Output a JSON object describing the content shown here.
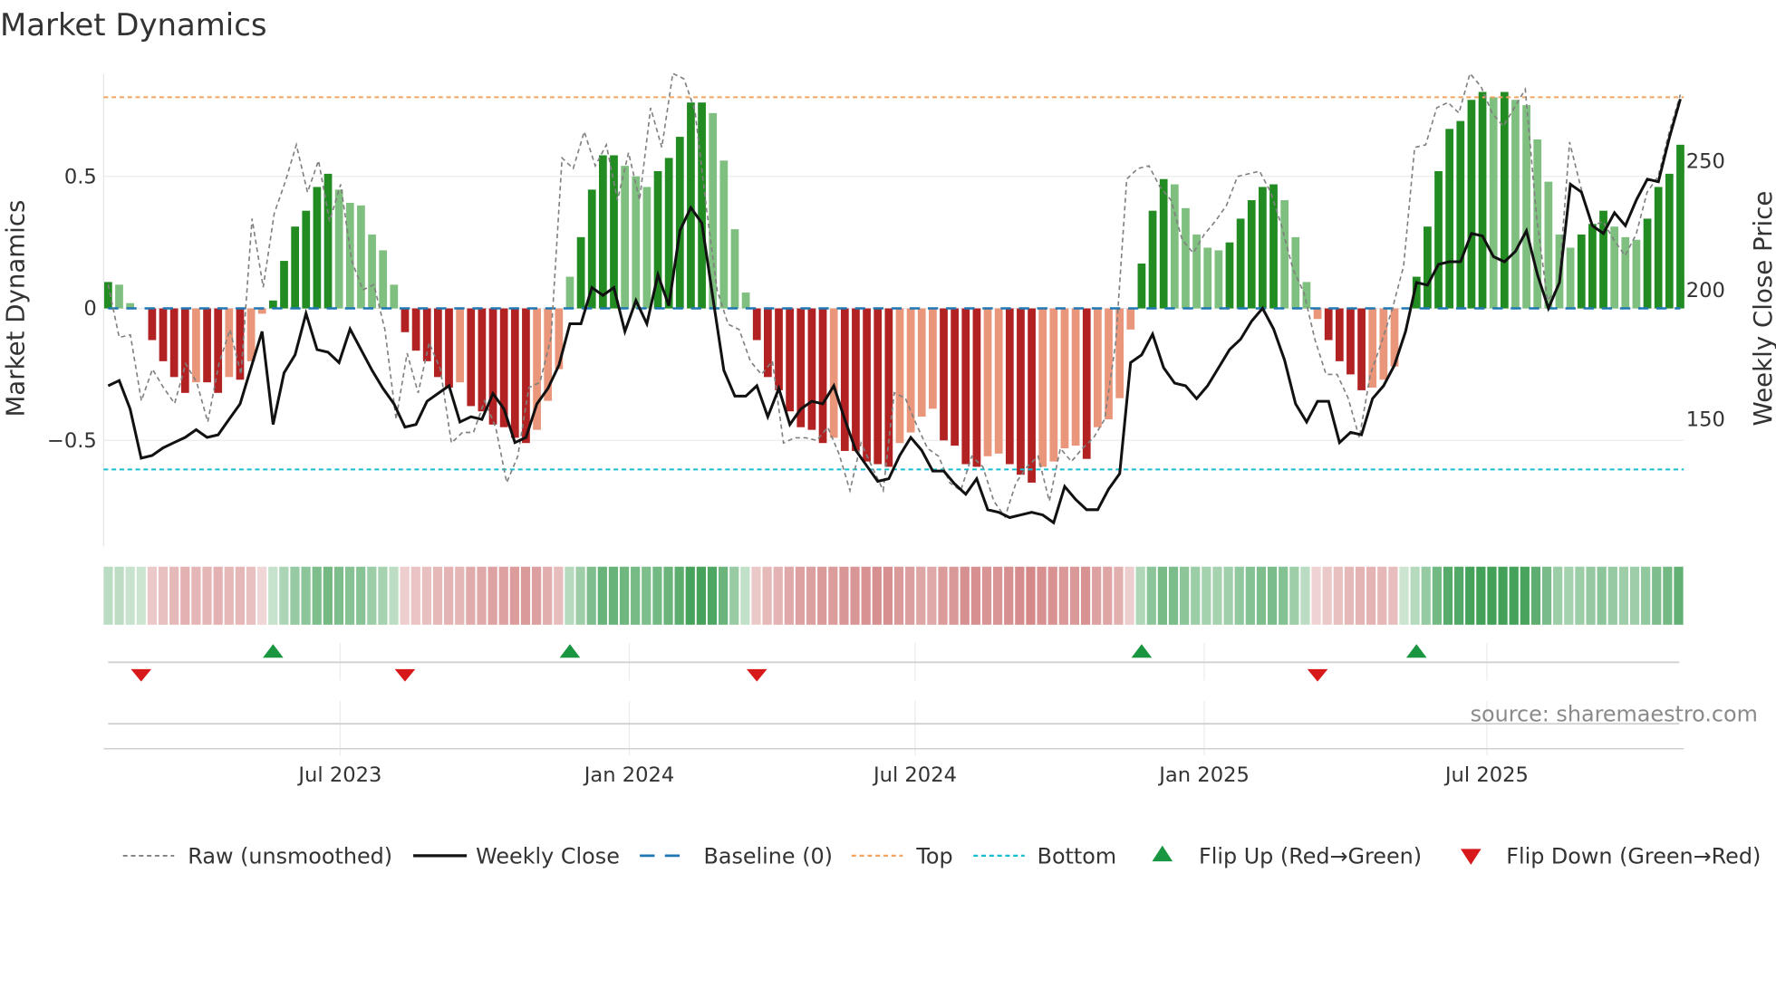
{
  "chart_data": {
    "type": "bar",
    "title": "Market Dynamics",
    "ylabel": "Market Dynamics",
    "y2label": "Weekly Close Price",
    "ylim": [
      -0.9,
      0.9
    ],
    "y2lim": [
      100,
      290
    ],
    "yticks": [
      {
        "value": 0.5,
        "label": "0.5"
      },
      {
        "value": 0,
        "label": "0"
      },
      {
        "value": -0.5,
        "label": "−0.5"
      }
    ],
    "y2ticks": [
      {
        "value": 250,
        "label": "250"
      },
      {
        "value": 200,
        "label": "200"
      },
      {
        "value": 150,
        "label": "150"
      }
    ],
    "x_week_range": [
      0,
      143
    ],
    "xticks": [
      {
        "week": 21.1,
        "label": "Jul 2023"
      },
      {
        "week": 47.4,
        "label": "Jan 2024"
      },
      {
        "week": 73.4,
        "label": "Jul 2024"
      },
      {
        "week": 99.7,
        "label": "Jan 2025"
      },
      {
        "week": 125.4,
        "label": "Jul 2025"
      }
    ],
    "top_level": 0.8,
    "bottom_level": -0.61,
    "baseline": 0,
    "smoothed_values": [
      0.1,
      0.09,
      0.02,
      0,
      -0.12,
      -0.2,
      -0.26,
      -0.32,
      -0.28,
      -0.28,
      -0.32,
      -0.26,
      -0.27,
      -0.2,
      -0.02,
      0.03,
      0.18,
      0.31,
      0.37,
      0.46,
      0.51,
      0.45,
      0.4,
      0.39,
      0.28,
      0.22,
      0.09,
      -0.09,
      -0.16,
      -0.2,
      -0.26,
      -0.3,
      -0.28,
      -0.37,
      -0.39,
      -0.44,
      -0.45,
      -0.49,
      -0.51,
      -0.46,
      -0.35,
      -0.23,
      0.12,
      0.27,
      0.45,
      0.58,
      0.58,
      0.54,
      0.5,
      0.46,
      0.52,
      0.57,
      0.65,
      0.78,
      0.78,
      0.74,
      0.56,
      0.3,
      0.06,
      -0.12,
      -0.26,
      -0.31,
      -0.39,
      -0.45,
      -0.46,
      -0.51,
      -0.49,
      -0.54,
      -0.54,
      -0.58,
      -0.59,
      -0.6,
      -0.51,
      -0.47,
      -0.41,
      -0.38,
      -0.5,
      -0.52,
      -0.59,
      -0.6,
      -0.56,
      -0.55,
      -0.59,
      -0.63,
      -0.66,
      -0.6,
      -0.58,
      -0.53,
      -0.52,
      -0.57,
      -0.45,
      -0.42,
      -0.34,
      -0.08,
      0.17,
      0.37,
      0.49,
      0.47,
      0.38,
      0.28,
      0.23,
      0.22,
      0.25,
      0.34,
      0.41,
      0.46,
      0.47,
      0.41,
      0.27,
      0.1,
      -0.04,
      -0.12,
      -0.2,
      -0.25,
      -0.31,
      -0.3,
      -0.27,
      -0.22,
      0.0,
      0.12,
      0.31,
      0.52,
      0.68,
      0.71,
      0.79,
      0.82,
      0.8,
      0.82,
      0.79,
      0.77,
      0.64,
      0.48,
      0.28,
      0.23,
      0.28,
      0.32,
      0.37,
      0.31,
      0.27,
      0.26,
      0.34,
      0.46,
      0.51,
      0.62
    ],
    "raw_values": [
      0.09,
      -0.11,
      -0.1,
      -0.35,
      -0.23,
      -0.3,
      -0.36,
      -0.21,
      -0.28,
      -0.43,
      -0.21,
      -0.08,
      -0.25,
      0.34,
      0.08,
      0.36,
      0.48,
      0.62,
      0.44,
      0.56,
      0.33,
      0.47,
      0.18,
      0.07,
      0.09,
      -0.08,
      -0.42,
      -0.17,
      -0.32,
      -0.13,
      -0.23,
      -0.51,
      -0.47,
      -0.47,
      -0.35,
      -0.45,
      -0.66,
      -0.56,
      -0.3,
      -0.28,
      -0.11,
      0.57,
      0.53,
      0.67,
      0.54,
      0.62,
      0.41,
      0.59,
      0.41,
      0.76,
      0.61,
      0.89,
      0.87,
      0.75,
      0.39,
      0.07,
      -0.06,
      -0.08,
      -0.2,
      -0.25,
      -0.2,
      -0.51,
      -0.49,
      -0.49,
      -0.5,
      -0.45,
      -0.55,
      -0.69,
      -0.51,
      -0.6,
      -0.69,
      -0.32,
      -0.34,
      -0.44,
      -0.53,
      -0.56,
      -0.66,
      -0.69,
      -0.56,
      -0.6,
      -0.73,
      -0.79,
      -0.66,
      -0.6,
      -0.56,
      -0.73,
      -0.53,
      -0.58,
      -0.53,
      -0.49,
      -0.42,
      -0.13,
      0.49,
      0.53,
      0.54,
      0.46,
      0.41,
      0.26,
      0.21,
      0.28,
      0.33,
      0.39,
      0.5,
      0.51,
      0.52,
      0.44,
      0.31,
      0.15,
      0.06,
      -0.12,
      -0.25,
      -0.25,
      -0.34,
      -0.49,
      -0.25,
      -0.13,
      0.0,
      0.16,
      0.61,
      0.62,
      0.76,
      0.78,
      0.74,
      0.89,
      0.84,
      0.74,
      0.69,
      0.76,
      0.83,
      0.35,
      0.03,
      0.08,
      0.63,
      0.46,
      0.31,
      0.33,
      0.26,
      0.2,
      0.28,
      0.44,
      0.5,
      0.67,
      0.81
    ],
    "weekly_close": [
      163,
      165,
      154,
      135,
      136,
      139,
      141,
      143,
      146,
      143,
      144,
      150,
      156,
      170,
      184,
      148,
      168,
      175,
      191,
      177,
      176,
      172,
      185,
      177,
      169,
      162,
      156,
      147,
      148,
      157,
      160,
      163,
      149,
      151,
      150,
      160,
      154,
      141,
      143,
      156,
      162,
      171,
      187,
      187,
      201,
      198,
      201,
      184,
      196,
      187,
      206,
      194,
      223,
      232,
      226,
      197,
      169,
      159,
      159,
      163,
      151,
      162,
      148,
      154,
      157,
      156,
      163,
      150,
      138,
      132,
      126,
      127,
      136,
      143,
      138,
      130,
      130,
      125,
      121,
      127,
      115,
      114,
      112,
      113,
      114,
      113,
      110,
      124,
      119,
      115,
      115,
      123,
      129,
      172,
      175,
      183,
      170,
      164,
      163,
      158,
      163,
      170,
      177,
      181,
      188,
      193,
      185,
      173,
      156,
      149,
      157,
      157,
      141,
      145,
      144,
      158,
      163,
      171,
      184,
      203,
      202,
      210,
      211,
      211,
      222,
      221,
      213,
      211,
      215,
      223,
      206,
      193,
      203,
      241,
      238,
      225,
      222,
      230,
      225,
      235,
      243,
      242,
      259,
      274
    ],
    "flip_up_weeks": [
      15,
      42,
      94,
      119
    ],
    "flip_down_weeks": [
      3,
      27,
      59,
      110
    ],
    "legend": [
      {
        "key": "raw",
        "label": "Raw (unsmoothed)"
      },
      {
        "key": "close",
        "label": "Weekly Close"
      },
      {
        "key": "baseline",
        "label": "Baseline (0)"
      },
      {
        "key": "top",
        "label": "Top"
      },
      {
        "key": "bottom",
        "label": "Bottom"
      },
      {
        "key": "flipup",
        "label": "Flip Up (Red→Green)"
      },
      {
        "key": "flipdown",
        "label": "Flip Down (Green→Red)"
      }
    ],
    "legend_position": "bottom",
    "source": "source: sharemaestro.com",
    "colors": {
      "green_strong": "#228b22",
      "green_weak": "#7fbf7f",
      "red_strong": "#b22222",
      "red_weak": "#e9967a",
      "raw": "#808080",
      "close": "#111111",
      "baseline": "#1f77b4",
      "top": "#f4a460",
      "bottom": "#17becf",
      "flip_up": "#1a9641",
      "flip_down": "#d7191c"
    }
  }
}
